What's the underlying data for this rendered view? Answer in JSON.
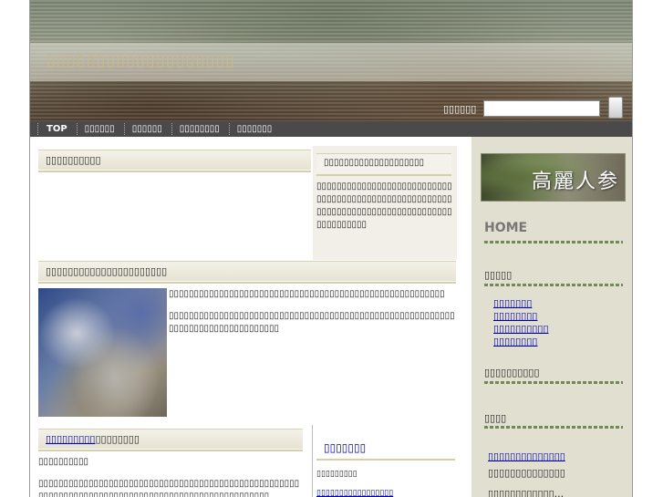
{
  "header": {
    "site_title": "▯▯▯▯▯▯▯▯▯▯▯▯▯▯▯▯▯▯▯",
    "search_label": "▯▯▯▯▯▯"
  },
  "nav": {
    "items": [
      "TOP",
      "▯▯▯▯▯▯",
      "▯▯▯▯▯▯",
      "▯▯▯▯▯▯▯▯",
      "▯▯▯▯▯▯▯"
    ]
  },
  "main": {
    "box1_title": "▯▯▯▯▯▯▯▯▯▯",
    "box2_title": "▯▯▯▯▯▯▯▯▯▯▯▯▯▯▯▯▯▯▯▯",
    "box2_text": "▯▯▯▯▯▯▯▯▯▯▯▯▯▯▯▯▯▯▯▯▯▯▯▯▯▯▯▯▯▯▯▯▯▯▯▯▯▯▯▯▯▯▯▯▯▯▯▯▯▯▯▯▯▯▯▯▯▯▯▯▯▯▯▯▯▯▯▯▯▯▯▯▯▯▯▯▯▯▯▯▯▯▯▯▯▯▯▯▯▯▯",
    "article_title": "▯▯▯▯▯▯▯▯▯▯▯▯▯▯▯▯▯▯▯▯▯▯",
    "article_p1": "▯▯▯▯▯▯▯▯▯▯▯▯▯▯▯▯▯▯▯▯▯▯▯▯▯▯▯▯▯▯▯▯▯▯▯▯▯▯▯▯▯▯▯▯▯▯▯▯▯▯▯▯▯▯▯",
    "article_p2": "▯▯▯▯▯▯▯▯▯▯▯▯▯▯▯▯▯▯▯▯▯▯▯▯▯▯▯▯▯▯▯▯▯▯▯▯▯▯▯▯▯▯▯▯▯▯▯▯▯▯▯▯▯▯▯▯▯▯▯▯▯▯▯▯▯▯▯▯▯▯▯▯▯▯▯▯▯▯▯",
    "section3_title_link": "▯▯▯▯▯▯▯▯▯",
    "section3_title_rest": "▯▯▯▯▯▯▯▯",
    "section3_sub": "▯▯▯▯▯▯▯▯▯▯",
    "section3_text": "▯▯▯▯▯▯▯▯▯▯▯▯▯▯▯▯▯▯▯▯▯▯▯▯▯▯▯▯▯▯▯▯▯▯▯▯▯▯▯▯▯▯▯▯▯▯▯▯▯▯▯▯▯▯▯▯▯▯▯▯▯▯▯▯▯▯▯▯▯▯▯▯▯▯▯▯▯▯▯▯▯▯▯▯▯▯▯▯▯▯▯▯▯▯▯▯▯▯",
    "section4_title": "▯▯▯▯▯▯▯",
    "section4_sub": "▯▯▯▯▯▯▯▯▯",
    "section4_link": "▯▯▯▯▯▯▯▯▯▯▯▯▯▯▯▯▯"
  },
  "sidebar": {
    "banner_text": "高麗人参",
    "home": "HOME",
    "cat_title": "▯▯▯▯▯",
    "cat_links": [
      "▯▯▯▯▯▯▯",
      "▯▯▯▯▯▯▯▯",
      "▯▯▯▯▯▯▯▯▯▯",
      "▯▯▯▯▯▯▯▯"
    ],
    "recent_title": "▯▯▯▯▯▯▯▯▯▯",
    "links_title": "▯▯▯▯",
    "links_link": "▯▯▯▯▯▯▯▯▯▯▯▯▯▯",
    "links_text": "▯▯▯▯▯▯▯▯▯▯▯▯▯▯",
    "links_more": "▯▯▯▯▯▯▯▯▯▯▯▯..."
  }
}
